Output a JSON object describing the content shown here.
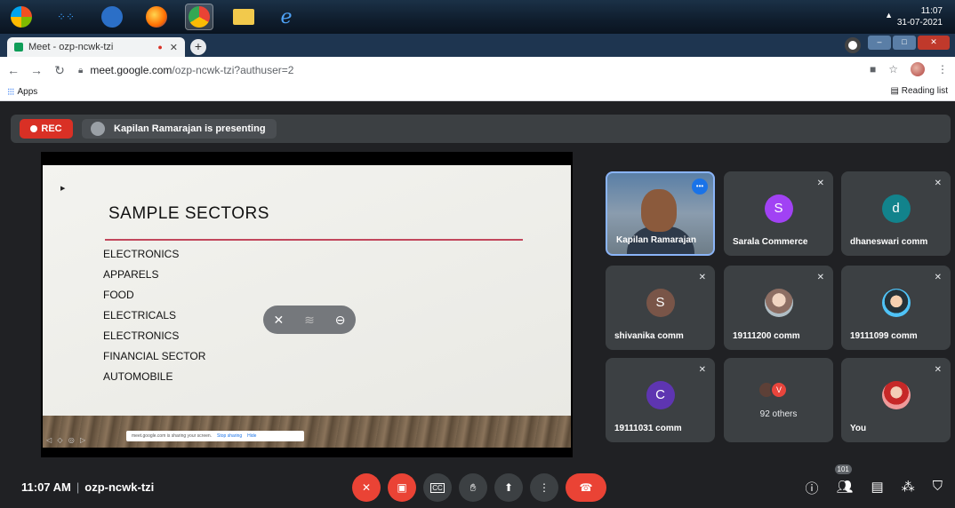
{
  "taskbar": {
    "clock_time": "11:07",
    "clock_date": "31-07-2021"
  },
  "browser": {
    "tab_title": "Meet - ozp-ncwk-tzi",
    "url_host": "meet.google.com",
    "url_path": "/ozp-ncwk-tzi?authuser=2",
    "bookmarks_apps": "Apps",
    "reading_list": "Reading list"
  },
  "meet": {
    "rec_label": "REC",
    "presenting_text": "Kapilan Ramarajan is presenting",
    "slide": {
      "title": "SAMPLE SECTORS",
      "items": [
        "ELECTRONICS",
        "APPARELS",
        "FOOD",
        "ELECTRICALS",
        "ELECTRONICS",
        "FINANCIAL SECTOR",
        "AUTOMOBILE"
      ],
      "share_notice": "meet.google.com is sharing your screen.",
      "stop_sharing": "Stop sharing",
      "hide": "Hide"
    },
    "tiles": [
      {
        "name": "Kapilan Ramarajan",
        "initial": "",
        "color": ""
      },
      {
        "name": "Sarala Commerce",
        "initial": "S",
        "color": "#a142f4"
      },
      {
        "name": "dhaneswari comm",
        "initial": "d",
        "color": "#12838c"
      },
      {
        "name": "shivanika comm",
        "initial": "S",
        "color": "#795548"
      },
      {
        "name": "19111200 comm",
        "initial": "",
        "color": ""
      },
      {
        "name": "19111099 comm",
        "initial": "",
        "color": ""
      },
      {
        "name": "19111031 comm",
        "initial": "C",
        "color": "#5e35b1"
      },
      {
        "name": "",
        "initial": "V",
        "color": "#e8453c"
      },
      {
        "name": "You",
        "initial": "",
        "color": ""
      }
    ],
    "others_label": "92 others",
    "meeting_time": "11:07 AM",
    "meeting_code": "ozp-ncwk-tzi",
    "participant_count": "101"
  }
}
